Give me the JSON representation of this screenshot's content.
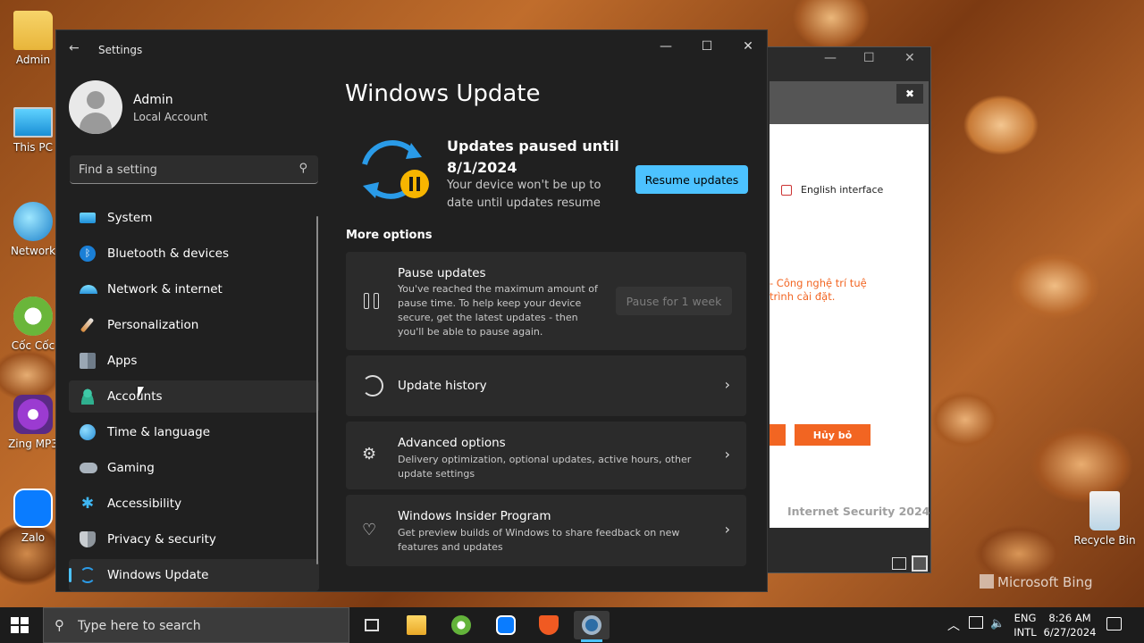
{
  "desktop": {
    "icons": [
      {
        "label": "Admin"
      },
      {
        "label": "This PC"
      },
      {
        "label": "Network"
      },
      {
        "label": "Cốc Cốc"
      },
      {
        "label": "Zing MP3"
      },
      {
        "label": "Zalo"
      },
      {
        "label": "Recycle Bin"
      }
    ],
    "watermark": "Microsoft Bing"
  },
  "background_window": {
    "checkbox_label": "English interface",
    "red_text_line1": "- Công nghệ trí tuệ",
    "red_text_line2": "trình cài đặt.",
    "cancel_button": "Hủy bỏ",
    "product_name": "Internet Security 2024",
    "close_glyph": "✖"
  },
  "settings": {
    "window_title": "Settings",
    "profile": {
      "name": "Admin",
      "type": "Local Account"
    },
    "search_placeholder": "Find a setting",
    "nav": [
      {
        "label": "System",
        "icon": "monitor-icon"
      },
      {
        "label": "Bluetooth & devices",
        "icon": "bluetooth-icon"
      },
      {
        "label": "Network & internet",
        "icon": "wifi-icon"
      },
      {
        "label": "Personalization",
        "icon": "brush-icon"
      },
      {
        "label": "Apps",
        "icon": "apps-icon"
      },
      {
        "label": "Accounts",
        "icon": "person-icon"
      },
      {
        "label": "Time & language",
        "icon": "globe-clock-icon"
      },
      {
        "label": "Gaming",
        "icon": "gamepad-icon"
      },
      {
        "label": "Accessibility",
        "icon": "accessibility-icon"
      },
      {
        "label": "Privacy & security",
        "icon": "shield-icon"
      },
      {
        "label": "Windows Update",
        "icon": "sync-icon"
      }
    ],
    "active_nav": "Windows Update",
    "page_title": "Windows Update",
    "status": {
      "title": "Updates paused until 8/1/2024",
      "description": "Your device won't be up to date until updates resume",
      "resume_button": "Resume updates"
    },
    "more_options_heading": "More options",
    "cards": {
      "pause": {
        "title": "Pause updates",
        "description": "You've reached the maximum amount of pause time. To help keep your device secure, get the latest updates - then you'll be able to pause again.",
        "button": "Pause for 1 week"
      },
      "history": {
        "title": "Update history"
      },
      "advanced": {
        "title": "Advanced options",
        "description": "Delivery optimization, optional updates, active hours, other update settings"
      },
      "insider": {
        "title": "Windows Insider Program",
        "description": "Get preview builds of Windows to share feedback on new features and updates"
      }
    }
  },
  "taskbar": {
    "search_placeholder": "Type here to search",
    "apps": [
      "task-view",
      "file-explorer",
      "coc-coc-browser",
      "zalo",
      "security-shield",
      "settings"
    ],
    "language_line1": "ENG",
    "language_line2": "INTL",
    "time": "8:26 AM",
    "date": "6/27/2024"
  },
  "colors": {
    "accent": "#4cc2ff",
    "window_bg": "#202020",
    "card_bg": "#2b2b2b",
    "cancel_orange": "#f26522"
  }
}
